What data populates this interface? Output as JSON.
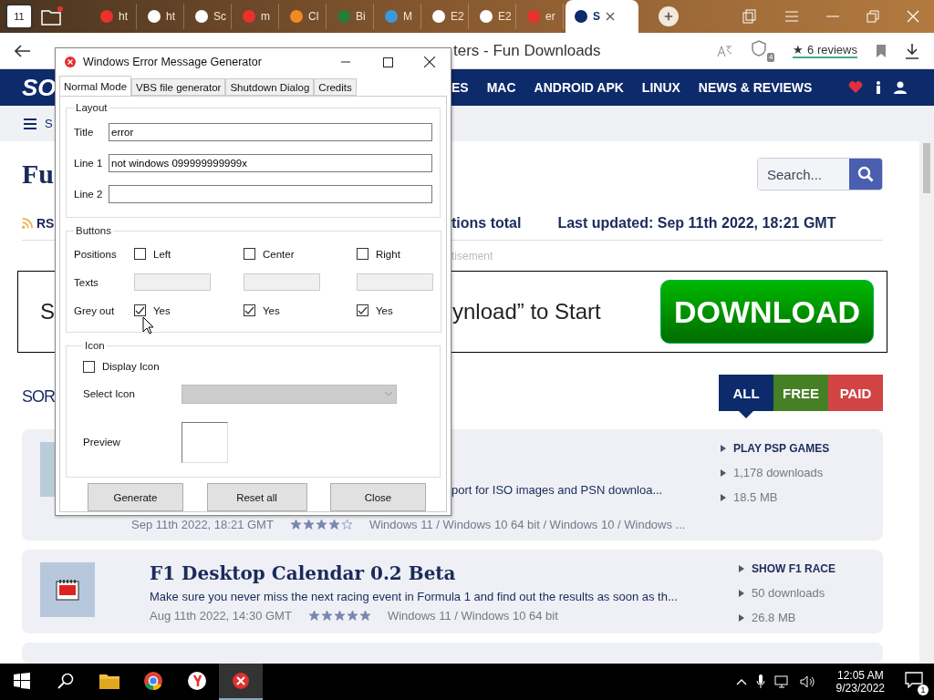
{
  "browser": {
    "home_badge": "11",
    "tabs": [
      {
        "label": "ht",
        "color": "#e8322b",
        "selected": false
      },
      {
        "label": "ht",
        "color": "#ffffff",
        "selected": false
      },
      {
        "label": "Sc",
        "color": "#ffffff",
        "selected": false
      },
      {
        "label": "m",
        "color": "#e8322b",
        "selected": false
      },
      {
        "label": "Cl",
        "color": "#f08a24",
        "selected": false
      },
      {
        "label": "Bi",
        "color": "#2a7a3a",
        "selected": false
      },
      {
        "label": "M",
        "color": "#3a9ad9",
        "selected": false
      },
      {
        "label": "E2",
        "color": "#ffffff",
        "selected": false
      },
      {
        "label": "E2",
        "color": "#ffffff",
        "selected": false
      },
      {
        "label": "er",
        "color": "#e8322b",
        "selected": false
      },
      {
        "label": "S",
        "color": "#0d2a6b",
        "selected": true
      }
    ],
    "page_title": "ters - Fun Downloads",
    "shield_badge": "4",
    "reviews": "★ 6 reviews"
  },
  "site": {
    "logo": "SO",
    "nav": [
      "ES",
      "MAC",
      "ANDROID APK",
      "LINUX",
      "NEWS & REVIEWS"
    ],
    "subnav": "S",
    "heading": "Fu",
    "search_placeholder": "Search...",
    "rss": "RS",
    "total": "tions total",
    "updated": "Last updated: Sep 11th 2022, 18:21 GMT",
    "ad_label": "tisement",
    "ad_left": "S",
    "ad_text": "ynload” to Start",
    "ad_button": "DOWNLOAD",
    "section": "SOR",
    "filters": [
      {
        "label": "ALL",
        "selected": true,
        "color": "#0d2a6b"
      },
      {
        "label": "FREE",
        "selected": false,
        "color": "#3d7a1a"
      },
      {
        "label": "PAID",
        "selected": false,
        "color": "#d03a3a"
      }
    ],
    "items": [
      {
        "description": "port for ISO images and PSN downloa...",
        "date": "Sep 11th 2022, 18:21 GMT",
        "stars": 4,
        "os": "Windows 11 / Windows 10 64 bit / Windows 10 / Windows ...",
        "link": "PLAY PSP GAMES",
        "downloads": "1,178 downloads",
        "size": "18.5 MB"
      },
      {
        "title": "F1 Desktop Calendar 0.2 Beta",
        "description": "Make sure you never miss the next racing event in Formula 1 and find out the results as soon as th...",
        "date": "Aug 11th 2022, 14:30 GMT",
        "stars": 5,
        "os": "Windows 11 / Windows 10 64 bit",
        "link": "SHOW F1 RACE",
        "downloads": "50 downloads",
        "size": "26.8 MB"
      }
    ]
  },
  "dialog": {
    "title": "Windows Error Message Generator",
    "tabs": [
      {
        "label": "Normal Mode",
        "selected": true
      },
      {
        "label": "VBS file generator",
        "selected": false
      },
      {
        "label": "Shutdown Dialog",
        "selected": false
      },
      {
        "label": "Credits",
        "selected": false
      }
    ],
    "layout": {
      "label": "Layout",
      "fields": [
        {
          "label": "Title",
          "value": "error"
        },
        {
          "label": "Line 1",
          "value": "not windows 099999999999x"
        },
        {
          "label": "Line 2"
        }
      ]
    },
    "buttons_group": {
      "label": "Buttons",
      "row_labels": [
        "Positions",
        "Texts",
        "Grey out"
      ],
      "columns": [
        {
          "position": "Left",
          "position_checked": false,
          "grey": "Yes",
          "grey_checked": true
        },
        {
          "position": "Center",
          "position_checked": false,
          "grey": "Yes",
          "grey_checked": true
        },
        {
          "position": "Right",
          "position_checked": false,
          "grey": "Yes",
          "grey_checked": true
        }
      ]
    },
    "icon_group": {
      "label": "Icon",
      "display": {
        "label": "Display Icon",
        "checked": false
      },
      "select_label": "Select Icon",
      "preview_label": "Preview"
    },
    "actions": [
      "Generate",
      "Reset all",
      "Close"
    ]
  },
  "taskbar": {
    "time": "12:05 AM",
    "date": "9/23/2022",
    "notifications": "1"
  }
}
